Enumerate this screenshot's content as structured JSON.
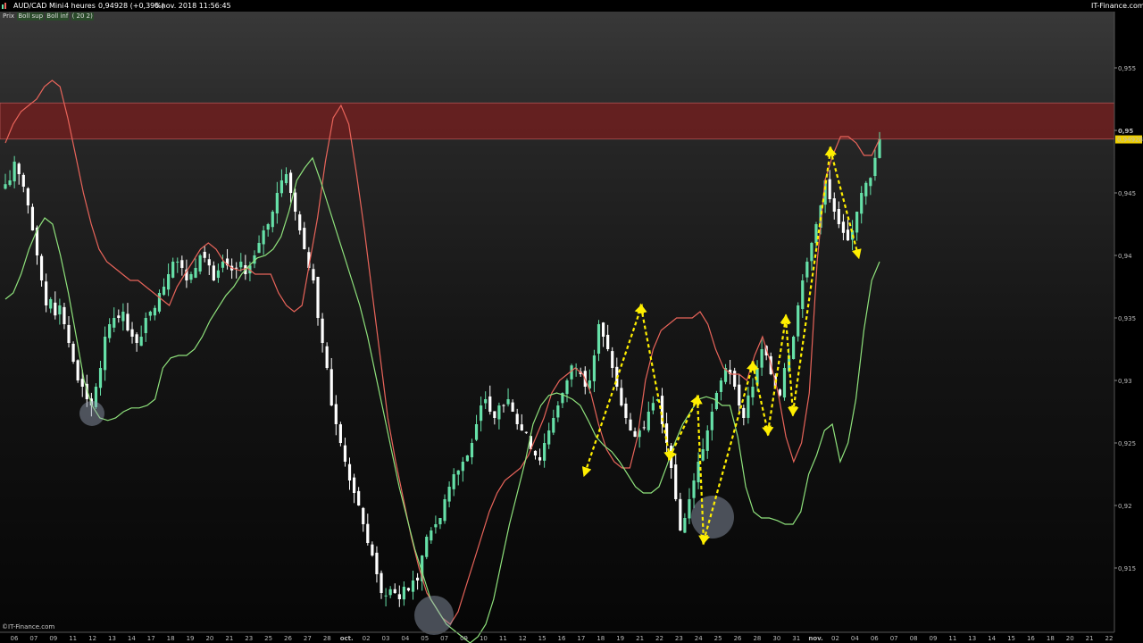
{
  "header": {
    "symbol": "AUD/CAD Mini",
    "timeframe": "4 heures",
    "quote": "0,94928 (+0,39%)",
    "datetime": "6 nov. 2018 11:56:45",
    "site": "IT-Finance.com"
  },
  "legend": {
    "price": "Prix",
    "bb_sup": "Boll sup",
    "bb_inf": "Boll inf",
    "params": "( 20 2)"
  },
  "footer": {
    "credit": "©IT-Finance.com"
  },
  "colors": {
    "bull": "#66e0a8",
    "bear": "#ffffff",
    "upper_band": "#e8645a",
    "lower_band": "#8fe27c",
    "zone": "#6e1e1e",
    "arrows": "#ffef00",
    "circles": "#9aa4b8",
    "price_tag": "#f0d000"
  },
  "chart_data": {
    "type": "candlestick",
    "title": "",
    "xlabel": "",
    "ylabel": "",
    "ylim": [
      0.91,
      0.9595
    ],
    "yticks": [
      "0,915",
      "0,92",
      "0,925",
      "0,93",
      "0,935",
      "0,94",
      "0,945",
      "0,95",
      "0,955"
    ],
    "last_price": "0,94928",
    "grid": false,
    "legend_position": "top-left",
    "xticks": [
      {
        "label": "06",
        "bold": false
      },
      {
        "label": "07",
        "bold": false
      },
      {
        "label": "09",
        "bold": false
      },
      {
        "label": "11",
        "bold": false
      },
      {
        "label": "12",
        "bold": false
      },
      {
        "label": "13",
        "bold": false
      },
      {
        "label": "14",
        "bold": false
      },
      {
        "label": "17",
        "bold": false
      },
      {
        "label": "18",
        "bold": false
      },
      {
        "label": "19",
        "bold": false
      },
      {
        "label": "20",
        "bold": false
      },
      {
        "label": "21",
        "bold": false
      },
      {
        "label": "23",
        "bold": false
      },
      {
        "label": "25",
        "bold": false
      },
      {
        "label": "26",
        "bold": false
      },
      {
        "label": "27",
        "bold": false
      },
      {
        "label": "28",
        "bold": false
      },
      {
        "label": "oct.",
        "bold": true
      },
      {
        "label": "02",
        "bold": false
      },
      {
        "label": "03",
        "bold": false
      },
      {
        "label": "04",
        "bold": false
      },
      {
        "label": "05",
        "bold": false
      },
      {
        "label": "07",
        "bold": false
      },
      {
        "label": "09",
        "bold": false
      },
      {
        "label": "10",
        "bold": false
      },
      {
        "label": "11",
        "bold": false
      },
      {
        "label": "12",
        "bold": false
      },
      {
        "label": "15",
        "bold": false
      },
      {
        "label": "16",
        "bold": false
      },
      {
        "label": "17",
        "bold": false
      },
      {
        "label": "18",
        "bold": false
      },
      {
        "label": "19",
        "bold": false
      },
      {
        "label": "21",
        "bold": false
      },
      {
        "label": "22",
        "bold": false
      },
      {
        "label": "23",
        "bold": false
      },
      {
        "label": "24",
        "bold": false
      },
      {
        "label": "25",
        "bold": false
      },
      {
        "label": "26",
        "bold": false
      },
      {
        "label": "28",
        "bold": false
      },
      {
        "label": "30",
        "bold": false
      },
      {
        "label": "31",
        "bold": false
      },
      {
        "label": "nov.",
        "bold": true
      },
      {
        "label": "02",
        "bold": false
      },
      {
        "label": "04",
        "bold": false
      },
      {
        "label": "06",
        "bold": false
      },
      {
        "label": "07",
        "bold": false
      },
      {
        "label": "08",
        "bold": false
      },
      {
        "label": "09",
        "bold": false
      },
      {
        "label": "11",
        "bold": false
      },
      {
        "label": "13",
        "bold": false
      },
      {
        "label": "14",
        "bold": false
      },
      {
        "label": "15",
        "bold": false
      },
      {
        "label": "16",
        "bold": false
      },
      {
        "label": "18",
        "bold": false
      },
      {
        "label": "20",
        "bold": false
      },
      {
        "label": "21",
        "bold": false
      },
      {
        "label": "22",
        "bold": false
      }
    ],
    "resistance_zone": [
      0.9493,
      0.9522
    ],
    "close_path": [
      0.9457,
      0.946,
      0.9475,
      0.9465,
      0.9455,
      0.944,
      0.942,
      0.94,
      0.938,
      0.936,
      0.9365,
      0.9352,
      0.936,
      0.9345,
      0.933,
      0.9315,
      0.93,
      0.9295,
      0.9285,
      0.928,
      0.9295,
      0.931,
      0.9335,
      0.9345,
      0.935,
      0.935,
      0.9355,
      0.934,
      0.9335,
      0.933,
      0.9335,
      0.935,
      0.9355,
      0.9358,
      0.937,
      0.9375,
      0.9385,
      0.9395,
      0.9395,
      0.939,
      0.938,
      0.9385,
      0.939,
      0.94,
      0.9398,
      0.9392,
      0.938,
      0.9388,
      0.9395,
      0.9392,
      0.9388,
      0.939,
      0.9395,
      0.9385,
      0.9392,
      0.94,
      0.941,
      0.942,
      0.9425,
      0.9435,
      0.945,
      0.946,
      0.9465,
      0.945,
      0.9435,
      0.942,
      0.9405,
      0.939,
      0.938,
      0.935,
      0.933,
      0.931,
      0.928,
      0.9265,
      0.925,
      0.9235,
      0.922,
      0.921,
      0.92,
      0.9185,
      0.917,
      0.916,
      0.9145,
      0.913,
      0.9128,
      0.9133,
      0.913,
      0.9125,
      0.9135,
      0.9132,
      0.914,
      0.914,
      0.916,
      0.9175,
      0.918,
      0.9185,
      0.919,
      0.9205,
      0.9215,
      0.9225,
      0.9228,
      0.9235,
      0.924,
      0.925,
      0.9265,
      0.928,
      0.9285,
      0.9275,
      0.927,
      0.928,
      0.928,
      0.9285,
      0.9275,
      0.9265,
      0.926,
      0.9258,
      0.9245,
      0.924,
      0.9236,
      0.925,
      0.926,
      0.927,
      0.928,
      0.929,
      0.93,
      0.9312,
      0.931,
      0.9305,
      0.9295,
      0.93,
      0.932,
      0.9345,
      0.9335,
      0.9325,
      0.931,
      0.9295,
      0.928,
      0.927,
      0.926,
      0.9255,
      0.926,
      0.9262,
      0.9275,
      0.9282,
      0.9285,
      0.9265,
      0.925,
      0.923,
      0.9205,
      0.918,
      0.919,
      0.9205,
      0.922,
      0.9235,
      0.9245,
      0.926,
      0.9275,
      0.929,
      0.93,
      0.931,
      0.9305,
      0.9295,
      0.928,
      0.927,
      0.9288,
      0.9295,
      0.931,
      0.9325,
      0.932,
      0.9305,
      0.9295,
      0.9288,
      0.931,
      0.932,
      0.9335,
      0.936,
      0.938,
      0.9395,
      0.941,
      0.9425,
      0.944,
      0.946,
      0.9445,
      0.9435,
      0.9425,
      0.9418,
      0.9412,
      0.942,
      0.9435,
      0.945,
      0.9458,
      0.9462,
      0.9478,
      0.9493
    ],
    "upper_band_path": [
      0.949,
      0.9505,
      0.9515,
      0.952,
      0.9525,
      0.9535,
      0.954,
      0.9535,
      0.951,
      0.948,
      0.945,
      0.9425,
      0.9405,
      0.9395,
      0.939,
      0.9385,
      0.938,
      0.938,
      0.9375,
      0.937,
      0.9365,
      0.936,
      0.9375,
      0.9385,
      0.9395,
      0.9405,
      0.941,
      0.9405,
      0.9395,
      0.939,
      0.9388,
      0.939,
      0.9385,
      0.9385,
      0.9385,
      0.937,
      0.936,
      0.9355,
      0.936,
      0.9395,
      0.943,
      0.9475,
      0.951,
      0.952,
      0.9505,
      0.9465,
      0.942,
      0.937,
      0.932,
      0.927,
      0.9235,
      0.9205,
      0.9175,
      0.915,
      0.913,
      0.912,
      0.911,
      0.9105,
      0.9115,
      0.9135,
      0.9155,
      0.9175,
      0.9195,
      0.921,
      0.922,
      0.9225,
      0.923,
      0.924,
      0.9255,
      0.927,
      0.929,
      0.93,
      0.9305,
      0.931,
      0.9305,
      0.929,
      0.9265,
      0.9245,
      0.9235,
      0.923,
      0.923,
      0.9255,
      0.93,
      0.9325,
      0.934,
      0.9345,
      0.935,
      0.935,
      0.935,
      0.9355,
      0.9345,
      0.9325,
      0.931,
      0.9305,
      0.9305,
      0.93,
      0.932,
      0.9335,
      0.9315,
      0.929,
      0.9255,
      0.9235,
      0.925,
      0.929,
      0.9395,
      0.946,
      0.948,
      0.9495,
      0.9495,
      0.949,
      0.948,
      0.948,
      0.9493
    ],
    "lower_band_path": [
      0.9365,
      0.937,
      0.9385,
      0.9405,
      0.942,
      0.943,
      0.9425,
      0.94,
      0.937,
      0.9335,
      0.93,
      0.928,
      0.927,
      0.9268,
      0.927,
      0.9275,
      0.9278,
      0.9278,
      0.928,
      0.9285,
      0.931,
      0.9318,
      0.932,
      0.932,
      0.9325,
      0.9335,
      0.9348,
      0.9358,
      0.9368,
      0.9375,
      0.9385,
      0.9392,
      0.9398,
      0.94,
      0.9405,
      0.9415,
      0.9435,
      0.946,
      0.947,
      0.9478,
      0.946,
      0.944,
      0.942,
      0.94,
      0.938,
      0.936,
      0.9335,
      0.9305,
      0.9275,
      0.9245,
      0.9215,
      0.919,
      0.9165,
      0.9145,
      0.9125,
      0.9115,
      0.9105,
      0.91,
      0.9095,
      0.909,
      0.9095,
      0.9105,
      0.9125,
      0.9155,
      0.9185,
      0.921,
      0.9235,
      0.9265,
      0.928,
      0.9288,
      0.929,
      0.9288,
      0.9285,
      0.928,
      0.9268,
      0.9255,
      0.9248,
      0.9243,
      0.9235,
      0.9225,
      0.9215,
      0.921,
      0.921,
      0.9215,
      0.9232,
      0.925,
      0.9265,
      0.9275,
      0.9285,
      0.9287,
      0.9285,
      0.928,
      0.928,
      0.9255,
      0.9215,
      0.9195,
      0.919,
      0.919,
      0.9188,
      0.9185,
      0.9185,
      0.9195,
      0.9225,
      0.924,
      0.926,
      0.9265,
      0.9235,
      0.925,
      0.9285,
      0.934,
      0.938,
      0.9395
    ]
  }
}
